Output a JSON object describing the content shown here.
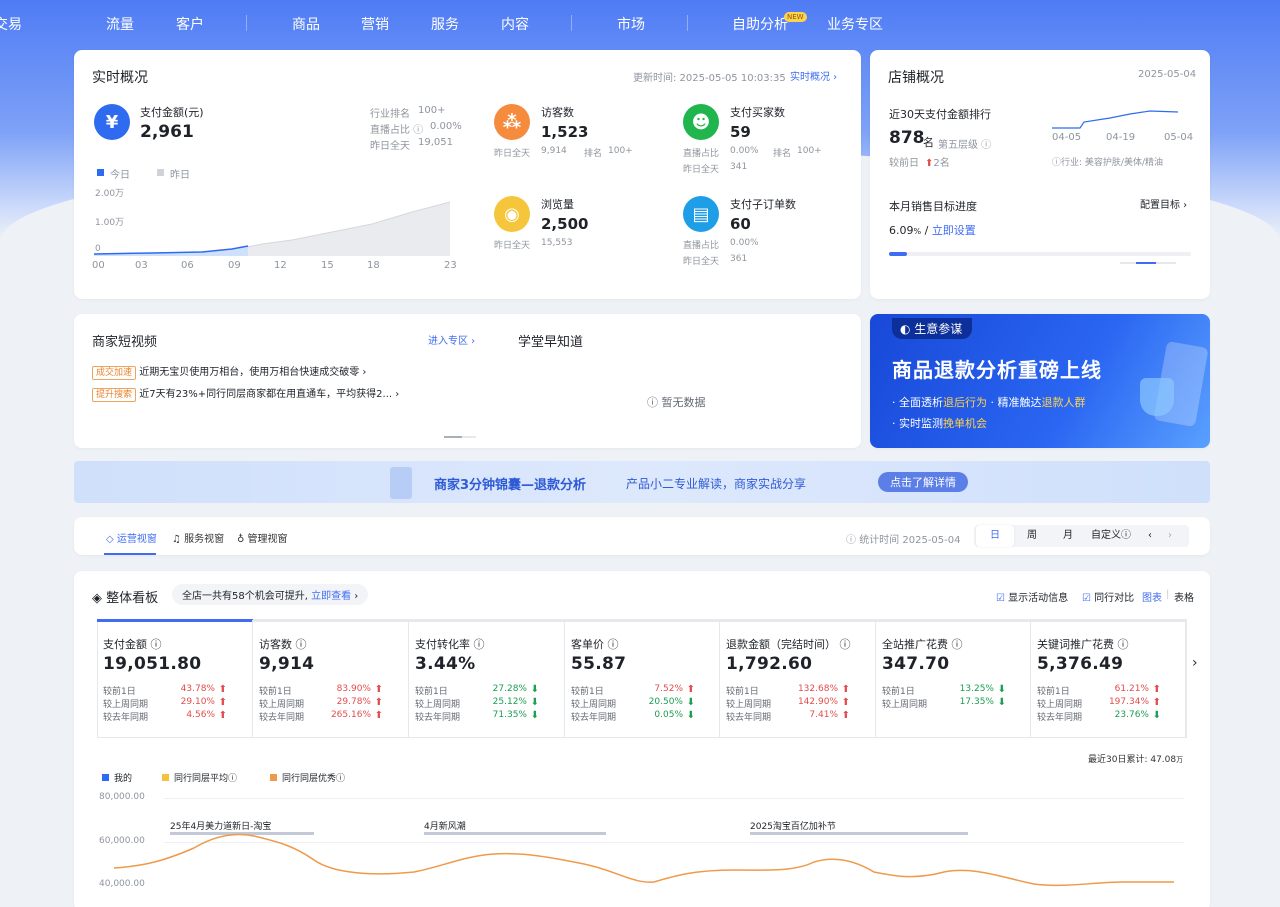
{
  "nav": {
    "items": [
      "交易",
      "流量",
      "客户",
      "商品",
      "营销",
      "服务",
      "内容",
      "市场",
      "自助分析",
      "业务专区"
    ],
    "new_badge": "NEW"
  },
  "realtime": {
    "title": "实时概况",
    "update_time": "更新时间: 2025-05-05 10:03:35",
    "link": "实时概况",
    "pay_amount": {
      "label": "支付金额(元)",
      "value": "2,961",
      "rank_label": "行业排名",
      "rank": "100+",
      "live_label": "直播占比",
      "live": "0.00%",
      "yday_label": "昨日全天",
      "yday": "19,051"
    },
    "legend_today": "今日",
    "legend_yday": "昨日",
    "y_ticks": [
      "2.00万",
      "1.00万",
      "0"
    ],
    "x_ticks": [
      "00",
      "03",
      "06",
      "09",
      "12",
      "15",
      "18",
      "23"
    ],
    "visitors": {
      "label": "访客数",
      "value": "1,523",
      "yday_label": "昨日全天",
      "yday": "9,914",
      "rank_label": "排名",
      "rank": "100+"
    },
    "buyers": {
      "label": "支付买家数",
      "value": "59",
      "live_label": "直播占比",
      "live": "0.00%",
      "rank_label": "排名",
      "rank": "100+",
      "yday_label": "昨日全天",
      "yday": "341"
    },
    "pageviews": {
      "label": "浏览量",
      "value": "2,500",
      "yday_label": "昨日全天",
      "yday": "15,553"
    },
    "suborders": {
      "label": "支付子订单数",
      "value": "60",
      "live_label": "直播占比",
      "live": "0.00%",
      "yday_label": "昨日全天",
      "yday": "361"
    }
  },
  "shop": {
    "title": "店铺概况",
    "date": "2025-05-04",
    "rank_title": "近30天支付金额排行",
    "rank": "878",
    "rank_unit": "名",
    "tier": "第五层级",
    "compare_label": "较前日",
    "compare": "2名",
    "industry": "行业: 美容护肤/美体/精油",
    "spark_ticks": [
      "04-05",
      "04-19",
      "05-04"
    ],
    "target_title": "本月销售目标进度",
    "target_link": "配置目标",
    "target_value": "6.09",
    "target_unit": "%",
    "target_set": "立即设置"
  },
  "videos": {
    "title": "商家短视频",
    "link": "进入专区",
    "items": [
      {
        "tag": "成交加速",
        "text": "近期无宝贝使用万相台，使用万相台快速成交破零"
      },
      {
        "tag": "提升搜索",
        "text": "近7天有23%+同行同层商家都在用直通车，平均获得2..."
      }
    ]
  },
  "school": {
    "title": "学堂早知道",
    "empty": "暂无数据"
  },
  "promo": {
    "brand": "生意参谋",
    "headline": "商品退款分析重磅上线",
    "line1a": "· 全面透析",
    "line1b": "退后行为",
    "line1c": "· 精准触达",
    "line1d": "退款人群",
    "line2a": "· 实时监测",
    "line2b": "挽单机会"
  },
  "strip": {
    "title": "商家3分钟锦囊—退款分析",
    "sub": "产品小二专业解读，商家实战分享",
    "button": "点击了解详情"
  },
  "views": {
    "tabs": [
      "运营视窗",
      "服务视窗",
      "管理视窗"
    ],
    "stat_time": "统计时间 2025-05-04",
    "periods": [
      "日",
      "周",
      "月",
      "自定义"
    ]
  },
  "board": {
    "title": "整体看板",
    "opportunity": "全店一共有58个机会可提升,",
    "opportunity_link": "立即查看",
    "show_activity": "显示活动信息",
    "peer_compare": "同行对比",
    "view_chart": "图表",
    "view_table": "表格",
    "kpis": [
      {
        "label": "支付金额",
        "value": "19,051.80",
        "rows": [
          [
            "较前1日",
            "43.78%",
            "up"
          ],
          [
            "较上周同期",
            "29.10%",
            "up"
          ],
          [
            "较去年同期",
            "4.56%",
            "up"
          ]
        ]
      },
      {
        "label": "访客数",
        "value": "9,914",
        "rows": [
          [
            "较前1日",
            "83.90%",
            "up"
          ],
          [
            "较上周同期",
            "29.78%",
            "up"
          ],
          [
            "较去年同期",
            "265.16%",
            "up"
          ]
        ]
      },
      {
        "label": "支付转化率",
        "value": "3.44%",
        "rows": [
          [
            "较前1日",
            "27.28%",
            "down"
          ],
          [
            "较上周同期",
            "25.12%",
            "down"
          ],
          [
            "较去年同期",
            "71.35%",
            "down"
          ]
        ]
      },
      {
        "label": "客单价",
        "value": "55.87",
        "rows": [
          [
            "较前1日",
            "7.52%",
            "up"
          ],
          [
            "较上周同期",
            "20.50%",
            "down"
          ],
          [
            "较去年同期",
            "0.05%",
            "down"
          ]
        ]
      },
      {
        "label": "退款金额（完结时间）",
        "value": "1,792.60",
        "rows": [
          [
            "较前1日",
            "132.68%",
            "up"
          ],
          [
            "较上周同期",
            "142.90%",
            "up"
          ],
          [
            "较去年同期",
            "7.41%",
            "up"
          ]
        ]
      },
      {
        "label": "全站推广花费",
        "value": "347.70",
        "rows": [
          [
            "较前1日",
            "13.25%",
            "down"
          ],
          [
            "较上周同期",
            "17.35%",
            "down"
          ]
        ]
      },
      {
        "label": "关键词推广花费",
        "value": "5,376.49",
        "rows": [
          [
            "较前1日",
            "61.21%",
            "up"
          ],
          [
            "较上周同期",
            "197.34%",
            "up"
          ],
          [
            "较去年同期",
            "23.76%",
            "down"
          ]
        ]
      }
    ],
    "cumulative": "最近30日累计: 47.08",
    "cumulative_unit": "万",
    "legend": [
      "我的",
      "同行同层平均",
      "同行同层优秀"
    ],
    "y_ticks": [
      "80,000.00",
      "60,000.00",
      "40,000.00"
    ],
    "events": [
      "25年4月美力道新日-淘宝",
      "4月新风潮",
      "2025淘宝百亿加补节"
    ]
  },
  "colors": {
    "accent": "#3f6cf3",
    "orange": "#ef9a4a",
    "red": "#e34d4d",
    "green": "#1a9e4f"
  }
}
